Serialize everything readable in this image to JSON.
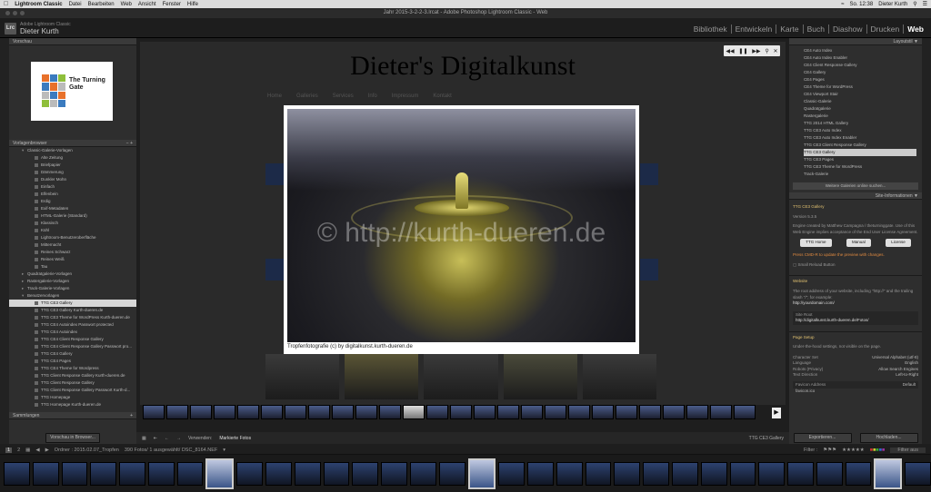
{
  "menubar": {
    "app": "Lightroom Classic",
    "items": [
      "Datei",
      "Bearbeiten",
      "Web",
      "Ansicht",
      "Fenster",
      "Hilfe"
    ],
    "clock": "So. 12:38",
    "user": "Dieter Kurth"
  },
  "window_title": "Jahr 2015-3-2-2-3.lrcat - Adobe Photoshop Lightroom Classic - Web",
  "identity": {
    "app": "Adobe Lightroom Classic",
    "user": "Dieter Kurth",
    "logo": "Lrc"
  },
  "modules": [
    "Bibliothek",
    "Entwickeln",
    "Karte",
    "Buch",
    "Diashow",
    "Drucken",
    "Web"
  ],
  "active_module": "Web",
  "left_panel": {
    "preview_header": "Vorschau",
    "preview_logo_text": "The Turning Gate",
    "templates_header": "Vorlagenbrowser",
    "collections_header": "Sammlungen",
    "tree": [
      {
        "label": "Classic-Galerie-Vorlagen",
        "level": 1,
        "type": "folder",
        "open": true
      },
      {
        "label": "Alte Zeitung",
        "level": 2,
        "type": "item"
      },
      {
        "label": "Briefpapier",
        "level": 2,
        "type": "item"
      },
      {
        "label": "Dämmerung",
        "level": 2,
        "type": "item"
      },
      {
        "label": "Dunkler Mohn",
        "level": 2,
        "type": "item"
      },
      {
        "label": "Einfach",
        "level": 2,
        "type": "item"
      },
      {
        "label": "Elfenbein",
        "level": 2,
        "type": "item"
      },
      {
        "label": "Erdig",
        "level": 2,
        "type": "item"
      },
      {
        "label": "Exif-Metadaten",
        "level": 2,
        "type": "item"
      },
      {
        "label": "HTML-Galerie (Standard)",
        "level": 2,
        "type": "item"
      },
      {
        "label": "Klassisch",
        "level": 2,
        "type": "item"
      },
      {
        "label": "Kühl",
        "level": 2,
        "type": "item"
      },
      {
        "label": "Lightroom-Benutzeroberfläche",
        "level": 2,
        "type": "item"
      },
      {
        "label": "Mitternacht",
        "level": 2,
        "type": "item"
      },
      {
        "label": "Reines Schwarz",
        "level": 2,
        "type": "item"
      },
      {
        "label": "Reines Weiß",
        "level": 2,
        "type": "item"
      },
      {
        "label": "Tau",
        "level": 2,
        "type": "item"
      },
      {
        "label": "Quadratgalerie-Vorlagen",
        "level": 1,
        "type": "folder",
        "open": false
      },
      {
        "label": "Rastergalerie-Vorlagen",
        "level": 1,
        "type": "folder",
        "open": false
      },
      {
        "label": "Track-Galerie-Vorlagen",
        "level": 1,
        "type": "folder",
        "open": false
      },
      {
        "label": "Benutzervorlagen",
        "level": 1,
        "type": "folder",
        "open": true
      },
      {
        "label": "TTG CE3 Gallery",
        "level": 2,
        "type": "item",
        "selected": true
      },
      {
        "label": "TTG CE3 Gallery Kurth-dueren.de",
        "level": 2,
        "type": "item"
      },
      {
        "label": "TTG CE3 Theme for WordPress Kurth-dueren.de",
        "level": 2,
        "type": "item"
      },
      {
        "label": "TTG CE4 Autoindex Passwort protected",
        "level": 2,
        "type": "item"
      },
      {
        "label": "TTG CE4 Autoindex",
        "level": 2,
        "type": "item"
      },
      {
        "label": "TTG CE4 Client Response Gallery",
        "level": 2,
        "type": "item"
      },
      {
        "label": "TTG CE4 Client Response Gallery Passwort pro...",
        "level": 2,
        "type": "item"
      },
      {
        "label": "TTG CE4 Gallery",
        "level": 2,
        "type": "item"
      },
      {
        "label": "TTG CE4 Pages",
        "level": 2,
        "type": "item"
      },
      {
        "label": "TTG CE4 Theme for Wordpress",
        "level": 2,
        "type": "item"
      },
      {
        "label": "TTG Client Response Gallery Kurth-dueren.de",
        "level": 2,
        "type": "item"
      },
      {
        "label": "TTG Client Response Gallery",
        "level": 2,
        "type": "item"
      },
      {
        "label": "TTG Client Response Gallery Passwort Kurth-d...",
        "level": 2,
        "type": "item"
      },
      {
        "label": "TTG Homepage",
        "level": 2,
        "type": "item"
      },
      {
        "label": "TTG Homepage Kurth-dueren.de",
        "level": 2,
        "type": "item"
      }
    ],
    "preview_button": "Vorschau in Browser..."
  },
  "center": {
    "site_title": "Dieter's Digitalkunst",
    "nav": [
      "Home",
      "Galleries",
      "Services",
      "Info",
      "Impressum",
      "Kontakt"
    ],
    "watermark": "© http://kurth-dueren.de",
    "caption": "Tropfenfotografie (c) by digitalkunst.kurth-dueren.de",
    "toolbar_use": "Verwenden:",
    "toolbar_use_value": "Markierte Fotos",
    "toolbar_right": "TTG CE3 Gallery"
  },
  "right_panel": {
    "layout_header": "Layoutstil",
    "layouts": [
      "CE4 Auto Index",
      "CE4 Auto Index Enabler",
      "CE4 Client Response Gallery",
      "CE4 Gallery",
      "CE4 Pages",
      "CE4 Theme for WordPress",
      "CE4 Viewport Stair",
      "Classic-Galerie",
      "Quadratgalerie",
      "Rastergalerie",
      "TTG 2014 HTML Gallery",
      "TTG CE3 Auto Index",
      "TTG CE3 Auto Index Enabler",
      "TTG CE3 Client Response Gallery",
      "TTG CE3 Gallery",
      "TTG CE3 Pages",
      "TTG CE3 Theme for WordPress",
      "Track-Galerie"
    ],
    "layout_selected": "TTG CE3 Gallery",
    "more_galleries": "Weitere Galerien online suchen...",
    "site_info_header": "Site-Informationen",
    "engine_name": "TTG CE3 Gallery",
    "engine_version": "Version 5.3.5",
    "engine_desc": "Engine created by Matthew Campagna / theturninggate. Use of this Web Engine implies acceptance of the End User License Agreement.",
    "btn_home": "TTG Home",
    "btn_manual": "Manual",
    "btn_license": "License",
    "cmd_hint": "Press CMD-R to update the preview with changes.",
    "small_reload": "Small Reload Button",
    "website_header": "Website",
    "website_desc": "The root address of your website, including \"http://\" and the trailing slash \"/\"; for example:",
    "website_example": "http://yourdomain.com/",
    "site_root_label": "Site Root",
    "site_root_value": "http://digitalkunst.kurth-dueren.de/Fotos/",
    "page_setup_header": "Page Setup",
    "page_setup_desc": "Under-the-hood settings, not visible on the page.",
    "settings": [
      {
        "label": "Character Set",
        "value": "Universal Alphabet (utf-8)"
      },
      {
        "label": "Language",
        "value": "English"
      },
      {
        "label": "Robots (Privacy)",
        "value": "Allow Search Engines"
      },
      {
        "label": "Text Direction",
        "value": "Left-to-Right"
      }
    ],
    "favicon_label": "Favicon Address",
    "favicon_value": "Default",
    "favicon_path": "favicon.ico",
    "export_button": "Exportieren...",
    "upload_button": "Hochladen..."
  },
  "filmbar": {
    "page1": "1",
    "page2": "2",
    "source": "Ordner : 2015.02.07_Tropfen",
    "count": "390 Fotos/ 1 ausgewählt/ DSC_8164.NEF",
    "filter_label": "Filter :",
    "filter_value": "Filter aus"
  }
}
